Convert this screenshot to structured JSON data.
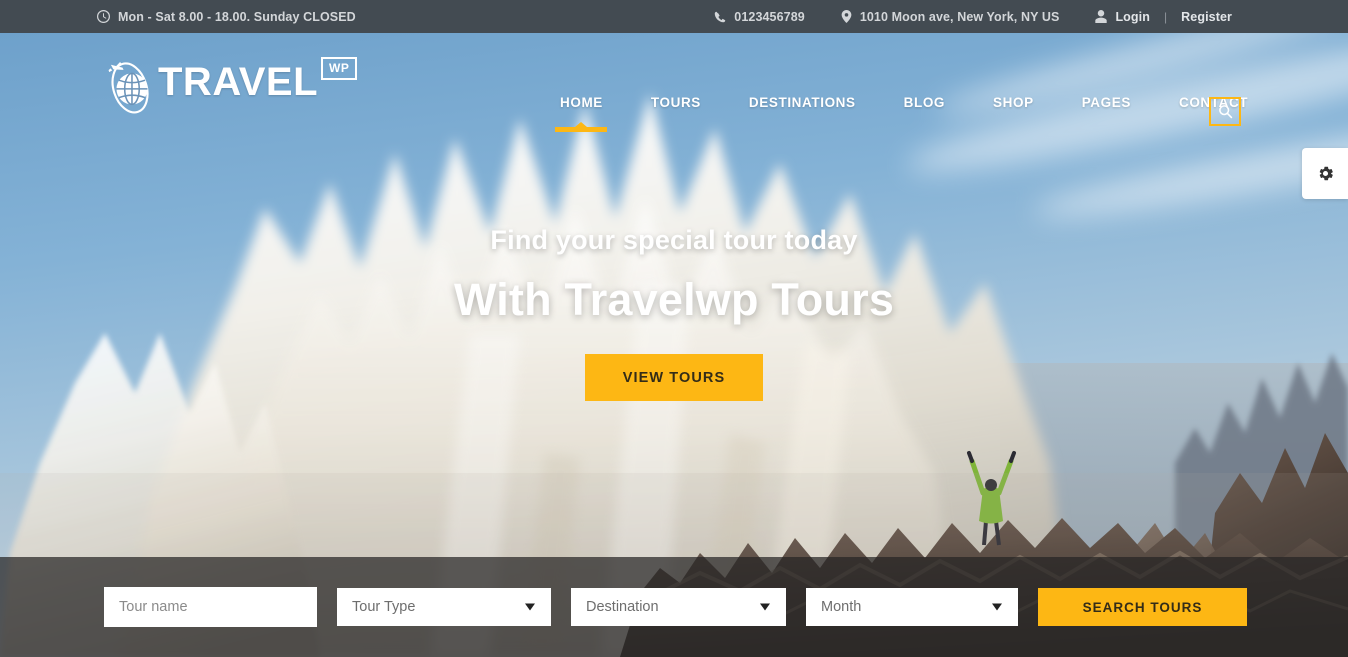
{
  "topbar": {
    "hours_icon": "clock-icon",
    "hours": "Mon - Sat 8.00 - 18.00. Sunday CLOSED",
    "phone_icon": "phone-icon",
    "phone": "0123456789",
    "location_icon": "map-pin-icon",
    "address": "1010 Moon ave, New York, NY US",
    "user_icon": "user-icon",
    "login": "Login",
    "separator": "|",
    "register": "Register"
  },
  "header": {
    "logo_text": "TRAVEL",
    "logo_badge": "WP",
    "logo_icon": "globe-airplane-icon",
    "search_icon": "search-icon",
    "nav": [
      {
        "label": "HOME",
        "active": true
      },
      {
        "label": "TOURS",
        "active": false
      },
      {
        "label": "DESTINATIONS",
        "active": false
      },
      {
        "label": "BLOG",
        "active": false
      },
      {
        "label": "SHOP",
        "active": false
      },
      {
        "label": "PAGES",
        "active": false
      },
      {
        "label": "CONTACT",
        "active": false
      }
    ]
  },
  "hero": {
    "subtitle": "Find your special tour today",
    "title": "With Travelwp Tours",
    "cta_label": "VIEW TOURS"
  },
  "settings": {
    "icon": "gear-icon"
  },
  "search_form": {
    "tour_name_placeholder": "Tour name",
    "tour_name_value": "",
    "tour_type_label": "Tour Type",
    "destination_label": "Destination",
    "month_label": "Month",
    "submit_label": "SEARCH TOURS"
  },
  "colors": {
    "accent": "#fdb714",
    "topbar_bg": "#434b52",
    "topbar_text": "#d3d6d9",
    "overlay": "rgba(38,36,36,0.72)"
  }
}
